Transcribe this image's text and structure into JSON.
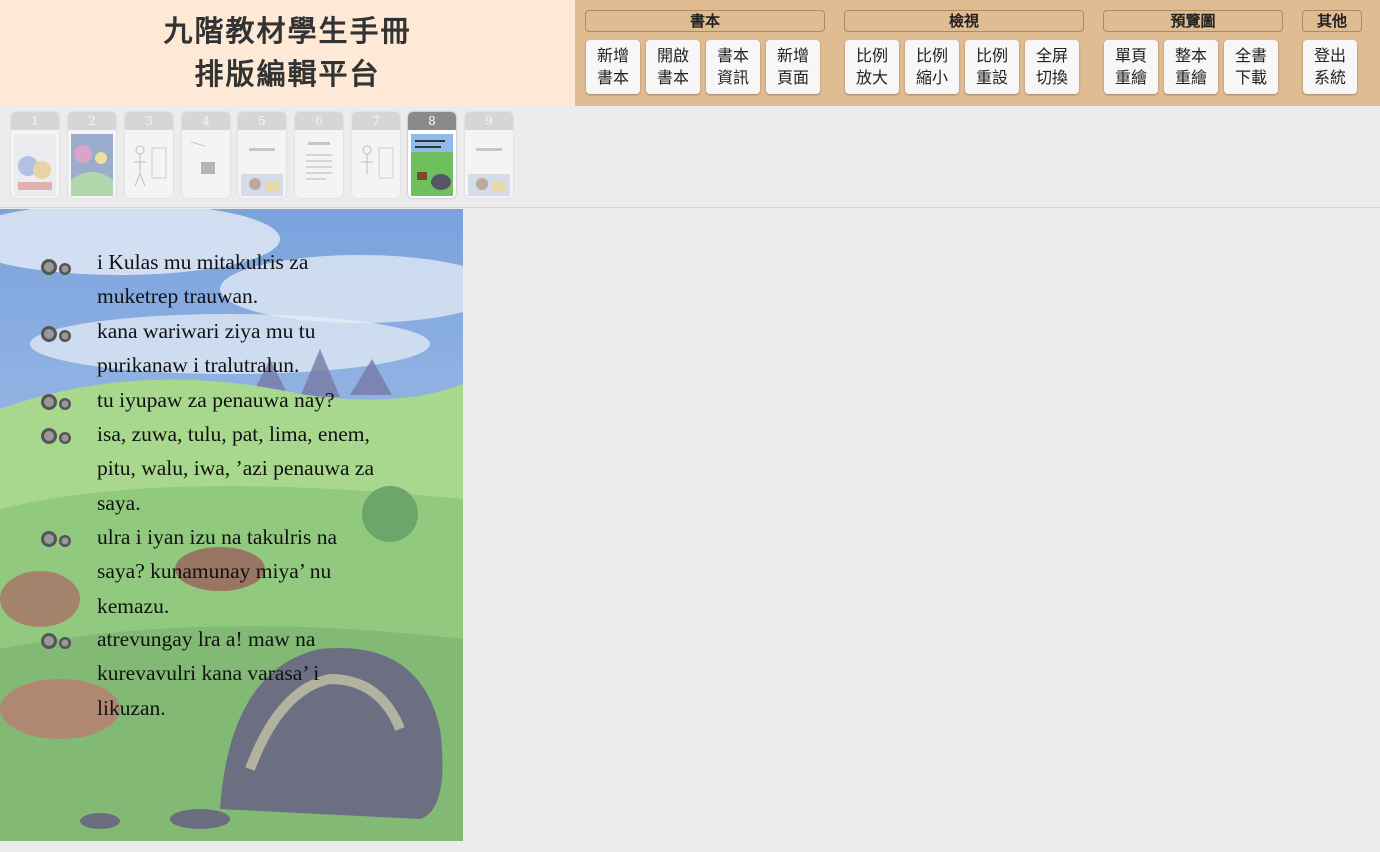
{
  "app": {
    "title_line1": "九階教材學生手冊",
    "title_line2": "排版編輯平台"
  },
  "toolbar": {
    "groups": [
      {
        "label": "書本",
        "buttons": [
          "新增\n書本",
          "開啟\n書本",
          "書本\n資訊",
          "新增\n頁面"
        ]
      },
      {
        "label": "檢視",
        "buttons": [
          "比例\n放大",
          "比例\n縮小",
          "比例\n重設",
          "全屏\n切換"
        ]
      },
      {
        "label": "預覽圖",
        "buttons": [
          "單頁\n重繪",
          "整本\n重繪",
          "全書\n下載"
        ]
      },
      {
        "label": "其他",
        "buttons": [
          "登出\n系統"
        ]
      }
    ]
  },
  "thumbnails": {
    "pages": [
      "1",
      "2",
      "3",
      "4",
      "5",
      "6",
      "7",
      "8",
      "9"
    ],
    "active_page": "8"
  },
  "page": {
    "lines": [
      "i Kulas mu mitakulris za muketrep trauwan.",
      "kana wariwari ziya mu tu purikanaw i tralutralun.",
      "tu iyupaw za penauwa nay?",
      "isa, zuwa, tulu, pat, lima, enem, pitu, walu, iwa, ’azi penauwa za saya.",
      "ulra i iyan izu na takulris na saya? kunamunay miya’ nu kemazu.",
      "atrevungay lra a! maw na kurevavulri kana varasa’ i likuzan."
    ]
  },
  "icons": {
    "speaker": "speaker-heads-icon"
  },
  "colors": {
    "title_bg": "#fde9d5",
    "toolbar_bg": "#e0bc92",
    "workspace_bg": "#ececec"
  }
}
